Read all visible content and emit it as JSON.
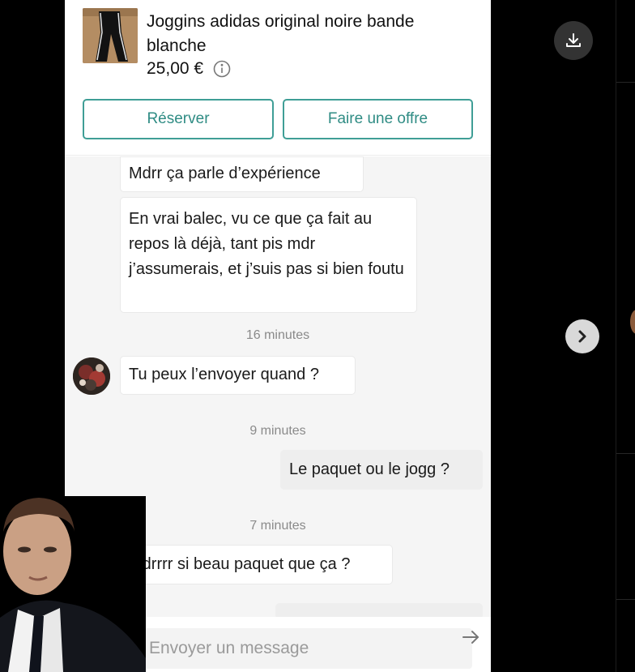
{
  "item": {
    "title": "Joggins adidas original noire bande blanche",
    "price": "25,00 €"
  },
  "actions": {
    "reserve_label": "Réserver",
    "offer_label": "Faire une offre"
  },
  "messages": [
    {
      "side": "in",
      "text": "Mdrr ça parle d’expérience"
    },
    {
      "side": "in",
      "text": "En vrai balec, vu ce que ça fait au repos là déjà, tant pis mdr j’assumerais, et j’suis pas si bien foutu"
    },
    {
      "side": "time",
      "text": "16 minutes"
    },
    {
      "side": "in",
      "text": "Tu peux l’envoyer quand ?"
    },
    {
      "side": "time",
      "text": "9 minutes"
    },
    {
      "side": "out",
      "text": "Le paquet ou le jogg ?"
    },
    {
      "side": "time",
      "text": "7 minutes"
    },
    {
      "side": "in",
      "text": "Mdrrrr si beau paquet que ça ?"
    }
  ],
  "composer": {
    "placeholder": "Envoyer un message"
  },
  "icons": {
    "download": "download-icon",
    "next": "chevron-right-icon",
    "info": "info-icon",
    "send": "arrow-right-icon"
  },
  "colors": {
    "accent": "#3f9e96",
    "accent_text": "#2f8c84",
    "chat_background": "#f5f5f5",
    "outgoing_bubble": "#eeeeee",
    "viewer_background": "#000000"
  }
}
